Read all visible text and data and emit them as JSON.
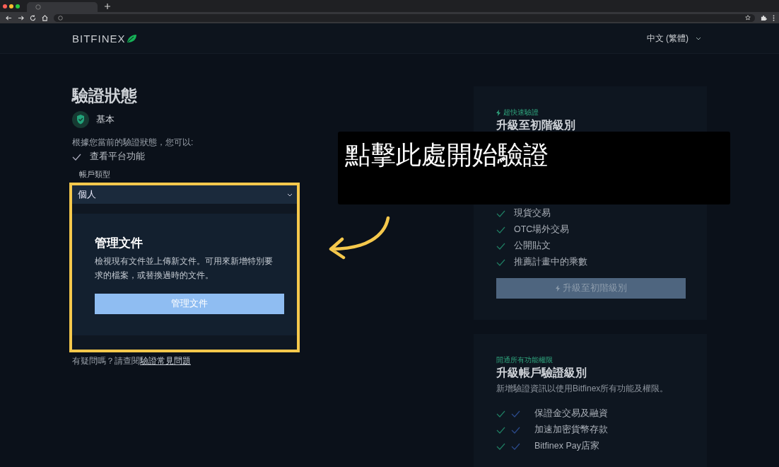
{
  "header": {
    "logo": "BITFINEX",
    "language": "中文 (繁體)"
  },
  "status": {
    "title": "驗證狀態",
    "level": "基本",
    "intro": "根據您當前的驗證狀態，您可以:",
    "features": [
      "查看平台功能"
    ],
    "account_type": {
      "label": "帳戶類型",
      "value": "個人"
    }
  },
  "documents": {
    "title": "管理文件",
    "description": "檢視現有文件並上傳新文件。可用來新增特別要求的檔案，或替換過時的文件。",
    "button": "管理文件"
  },
  "help": {
    "text": "有疑問嗎？請查閱",
    "link": "驗證常見問題"
  },
  "callout": {
    "text": "點擊此處開始驗證"
  },
  "cards": [
    {
      "kind": "quick",
      "tag": "超快速驗證",
      "title": "升級至初階級別",
      "features": [
        "現貨交易",
        "OTC場外交易",
        "公開貼文",
        "推薦計畫中的乘數"
      ],
      "button": {
        "label": "升級至初階級別",
        "disabled": true
      }
    },
    {
      "kind": "full",
      "tag": "開通所有功能權限",
      "title": "升級帳戶驗證級別",
      "description": "新增驗證資訊以使用Bitfinex所有功能及權限。",
      "features": [
        "保證金交易及融資",
        "加速加密貨幣存款",
        "Bitfinex Pay店家"
      ]
    }
  ]
}
